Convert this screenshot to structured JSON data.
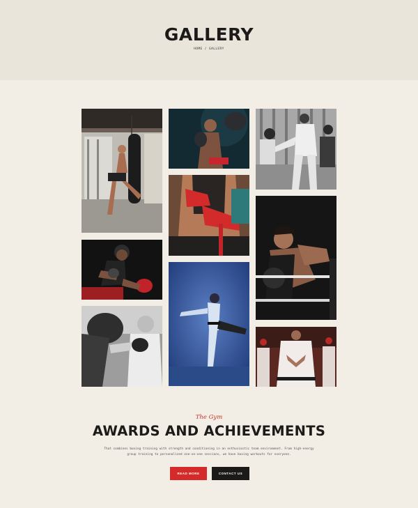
{
  "hero": {
    "title": "GALLERY",
    "breadcrumb": {
      "home": "HOME",
      "separator": "/",
      "current": "GALLERY"
    }
  },
  "gallery": {
    "tiles": [
      {
        "name": "heavy-bag-kick-photo",
        "tone": "warm-grey"
      },
      {
        "name": "boxer-portrait-photo",
        "tone": "teal-dark"
      },
      {
        "name": "karate-sparring-photo",
        "tone": "monochrome"
      },
      {
        "name": "hand-wraps-photo",
        "tone": "warm-red"
      },
      {
        "name": "crouching-boxer-photo",
        "tone": "dark-red"
      },
      {
        "name": "fighter-ringside-photo",
        "tone": "dark"
      },
      {
        "name": "high-kick-photo",
        "tone": "blue"
      },
      {
        "name": "kids-boxing-photo",
        "tone": "monochrome"
      },
      {
        "name": "karate-class-photo",
        "tone": "warm-red"
      }
    ]
  },
  "about": {
    "script_heading": "The Gym",
    "title": "AWARDS AND ACHIEVEMENTS",
    "description_line1": "That combines boxing training with strength and conditioning in an enthusiastic team environment. From high-energy",
    "description_line2": "group training to personalized one-on-one sessions, we have boxing workouts for everyone.",
    "primary_button": "READ MORE",
    "secondary_button": "CONTACT US"
  },
  "colors": {
    "accent": "#d42a2a",
    "dark": "#1b1a18",
    "background": "#f2eee5",
    "hero_background": "#e9e5db"
  }
}
